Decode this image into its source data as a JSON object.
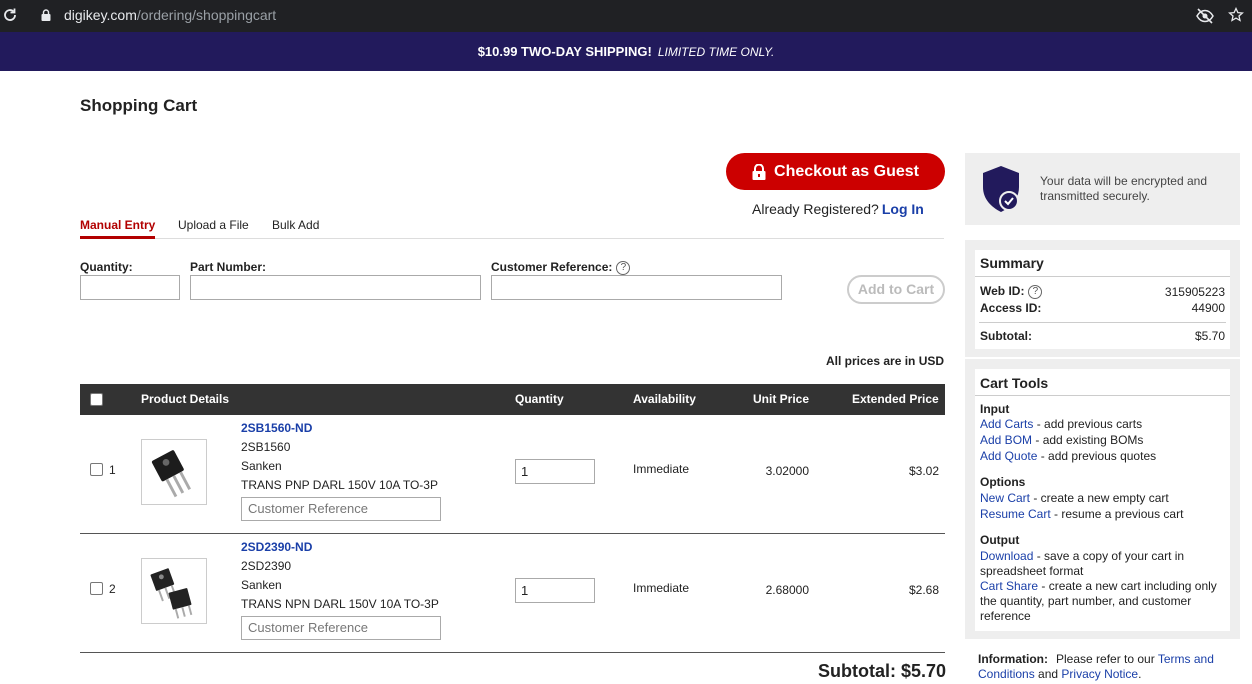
{
  "browser": {
    "url_domain": "digikey.com",
    "url_path": "/ordering/shoppingcart"
  },
  "promo": {
    "bold": "$10.99 TWO-DAY SHIPPING!",
    "italic": "LIMITED TIME ONLY."
  },
  "page_title": "Shopping Cart",
  "checkout": {
    "label": "Checkout as Guest",
    "already": "Already Registered?",
    "login": "Log In"
  },
  "tabs": [
    {
      "label": "Manual Entry",
      "active": true
    },
    {
      "label": "Upload a File",
      "active": false
    },
    {
      "label": "Bulk Add",
      "active": false
    }
  ],
  "form": {
    "quantity_label": "Quantity:",
    "part_label": "Part Number:",
    "ref_label": "Customer Reference:",
    "add_to_cart": "Add to Cart",
    "prices_note": "All prices are in USD"
  },
  "table": {
    "headers": {
      "details": "Product Details",
      "quantity": "Quantity",
      "availability": "Availability",
      "unit_price": "Unit Price",
      "extended_price": "Extended Price"
    },
    "rows": [
      {
        "num": "1",
        "part_link": "2SB1560-ND",
        "mfr_part": "2SB1560",
        "manufacturer": "Sanken",
        "description": "TRANS PNP DARL 150V 10A TO-3P",
        "ref_placeholder": "Customer Reference",
        "qty": "1",
        "availability": "Immediate",
        "unit": "3.02000",
        "extended": "$3.02"
      },
      {
        "num": "2",
        "part_link": "2SD2390-ND",
        "mfr_part": "2SD2390",
        "manufacturer": "Sanken",
        "description": "TRANS NPN DARL 150V 10A TO-3P",
        "ref_placeholder": "Customer Reference",
        "qty": "1",
        "availability": "Immediate",
        "unit": "2.68000",
        "extended": "$2.68"
      }
    ],
    "subtotal": "Subtotal: $5.70"
  },
  "secure_note": "Your data will be encrypted and transmitted securely.",
  "summary": {
    "title": "Summary",
    "web_id_label": "Web ID:",
    "web_id": "315905223",
    "access_id_label": "Access ID:",
    "access_id": "44900",
    "subtotal_label": "Subtotal:",
    "subtotal": "$5.70"
  },
  "cart_tools": {
    "title": "Cart Tools",
    "input_head": "Input",
    "add_carts": "Add Carts",
    "add_carts_desc": " - add previous carts",
    "add_bom": "Add BOM",
    "add_bom_desc": " - add existing BOMs",
    "add_quote": "Add Quote",
    "add_quote_desc": " - add previous quotes",
    "options_head": "Options",
    "new_cart": "New Cart",
    "new_cart_desc": " - create a new empty cart",
    "resume_cart": "Resume Cart",
    "resume_cart_desc": " - resume a previous cart",
    "output_head": "Output",
    "download": "Download",
    "download_desc": " - save a copy of your cart in spreadsheet format",
    "cart_share": "Cart Share",
    "cart_share_desc": " - create a new cart including only the quantity, part number, and customer reference"
  },
  "info": {
    "label": "Information:",
    "text1": "Please refer to our ",
    "terms": "Terms and Conditions",
    "and": " and ",
    "privacy": "Privacy Notice",
    "end": "."
  },
  "colors": {
    "brand_red": "#cc0000",
    "banner_navy": "#221a5c",
    "link_blue": "#1a3fa8"
  }
}
